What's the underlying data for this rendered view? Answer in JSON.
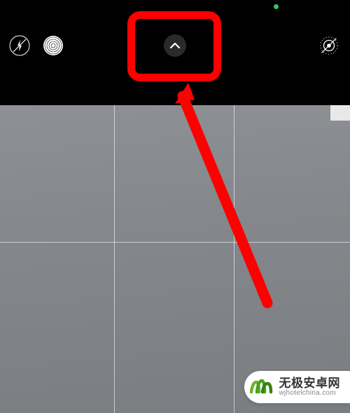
{
  "status": {
    "indicator": "camera-active"
  },
  "topbar": {
    "flash_state": "off",
    "night_state": "on",
    "live_state": "off"
  },
  "annotation": {
    "highlight_target": "expand-controls",
    "arrow_color": "#ff0000"
  },
  "watermark": {
    "title": "无极安卓网",
    "url": "wjhotelchina.com"
  }
}
